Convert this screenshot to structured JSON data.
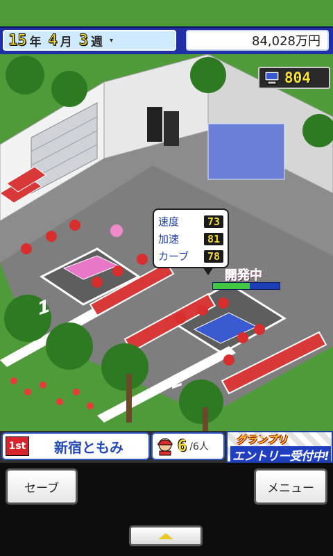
{
  "date": {
    "year": "15",
    "year_unit": "年",
    "month": "4",
    "month_unit": "月",
    "week": "3",
    "week_unit": "週",
    "caret": "▾"
  },
  "money": "84,028万円",
  "research_points": "804",
  "car_stats": [
    {
      "label": "速度",
      "value": "73"
    },
    {
      "label": "加速",
      "value": "81"
    },
    {
      "label": "カーブ",
      "value": "78"
    }
  ],
  "development": {
    "label": "開発中",
    "progress": 0.55
  },
  "garage_numbers": [
    "1",
    "2"
  ],
  "driver": {
    "rank": "1st",
    "name": "新宿ともみ"
  },
  "staff": {
    "current": "6",
    "total": "/6人"
  },
  "grand_prix": {
    "line1": "グランプリ",
    "line2": "エントリー受付中!"
  },
  "buttons": {
    "save": "セーブ",
    "menu": "メニュー"
  },
  "colors": {
    "hud_blue": "#1f2fa5",
    "dev_pink": "#e23b9a",
    "track_gray": "#7e7e7e"
  }
}
